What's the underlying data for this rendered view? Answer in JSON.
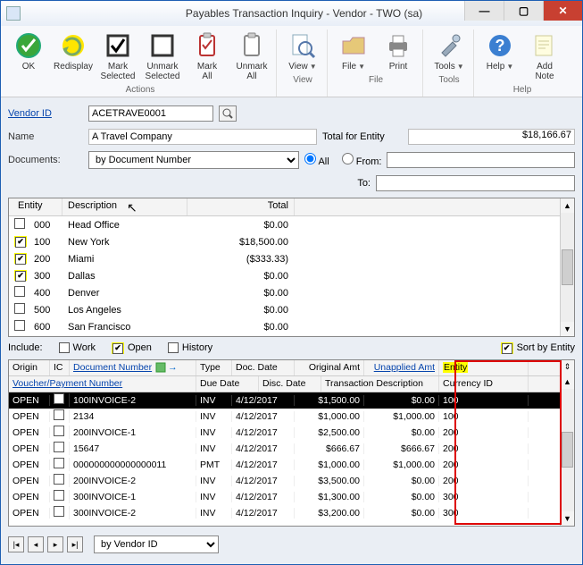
{
  "window": {
    "title": "Payables Transaction Inquiry - Vendor  -  TWO (sa)"
  },
  "ribbon": {
    "ok": "OK",
    "redisplay": "Redisplay",
    "mark_sel": "Mark\nSelected",
    "unmark_sel": "Unmark\nSelected",
    "mark_all": "Mark\nAll",
    "unmark_all": "Unmark\nAll",
    "view": "View",
    "file": "File",
    "print": "Print",
    "tools": "Tools",
    "help": "Help",
    "add_note": "Add\nNote",
    "group_actions": "Actions",
    "group_view": "View",
    "group_file": "File",
    "group_tools": "Tools",
    "group_help": "Help"
  },
  "form": {
    "vendor_id_label": "Vendor ID",
    "vendor_id": "ACETRAVE0001",
    "name_label": "Name",
    "name_value": "A Travel Company",
    "total_entity_label": "Total for Entity",
    "total_entity_value": "$18,166.67",
    "documents_label": "Documents:",
    "documents_value": "by Document Number",
    "all_label": "All",
    "from_label": "From:",
    "to_label": "To:"
  },
  "entity_grid": {
    "h_entity": "Entity",
    "h_desc": "Description",
    "h_total": "Total",
    "rows": [
      {
        "checked": false,
        "hl": false,
        "entity": "000",
        "desc": "Head Office",
        "total": "$0.00"
      },
      {
        "checked": true,
        "hl": true,
        "entity": "100",
        "desc": "New York",
        "total": "$18,500.00"
      },
      {
        "checked": true,
        "hl": true,
        "entity": "200",
        "desc": "Miami",
        "total": "($333.33)"
      },
      {
        "checked": true,
        "hl": true,
        "entity": "300",
        "desc": "Dallas",
        "total": "$0.00"
      },
      {
        "checked": false,
        "hl": false,
        "entity": "400",
        "desc": "Denver",
        "total": "$0.00"
      },
      {
        "checked": false,
        "hl": false,
        "entity": "500",
        "desc": "Los Angeles",
        "total": "$0.00"
      },
      {
        "checked": false,
        "hl": false,
        "entity": "600",
        "desc": "San Francisco",
        "total": "$0.00"
      }
    ]
  },
  "include": {
    "label": "Include:",
    "work": "Work",
    "open": "Open",
    "history": "History",
    "sort": "Sort by Entity"
  },
  "trans": {
    "h_origin": "Origin",
    "h_ic": "IC",
    "h_docnum": "Document Number",
    "h_type": "Type",
    "h_docdate": "Doc. Date",
    "h_orig": "Original Amt",
    "h_unapplied": "Unapplied Amt",
    "h_entity": "Entity",
    "h_vouch": "Voucher/Payment Number",
    "h_due": "Due Date",
    "h_disc": "Disc. Date",
    "h_transdesc": "Transaction Description",
    "h_curr": "Currency ID",
    "rows": [
      {
        "sel": true,
        "origin": "OPEN",
        "doc": "100INVOICE-2",
        "type": "INV",
        "date": "4/12/2017",
        "orig": "$1,500.00",
        "un": "$0.00",
        "ent": "100"
      },
      {
        "sel": false,
        "origin": "OPEN",
        "doc": "2134",
        "type": "INV",
        "date": "4/12/2017",
        "orig": "$1,000.00",
        "un": "$1,000.00",
        "ent": "100"
      },
      {
        "sel": false,
        "origin": "OPEN",
        "doc": "200INVOICE-1",
        "type": "INV",
        "date": "4/12/2017",
        "orig": "$2,500.00",
        "un": "$0.00",
        "ent": "200"
      },
      {
        "sel": false,
        "origin": "OPEN",
        "doc": "15647",
        "type": "INV",
        "date": "4/12/2017",
        "orig": "$666.67",
        "un": "$666.67",
        "ent": "200"
      },
      {
        "sel": false,
        "origin": "OPEN",
        "doc": "000000000000000011",
        "type": "PMT",
        "date": "4/12/2017",
        "orig": "$1,000.00",
        "un": "$1,000.00",
        "ent": "200"
      },
      {
        "sel": false,
        "origin": "OPEN",
        "doc": "200INVOICE-2",
        "type": "INV",
        "date": "4/12/2017",
        "orig": "$3,500.00",
        "un": "$0.00",
        "ent": "200"
      },
      {
        "sel": false,
        "origin": "OPEN",
        "doc": "300INVOICE-1",
        "type": "INV",
        "date": "4/12/2017",
        "orig": "$1,300.00",
        "un": "$0.00",
        "ent": "300"
      },
      {
        "sel": false,
        "origin": "OPEN",
        "doc": "300INVOICE-2",
        "type": "INV",
        "date": "4/12/2017",
        "orig": "$3,200.00",
        "un": "$0.00",
        "ent": "300"
      }
    ]
  },
  "nav": {
    "by": "by Vendor ID"
  }
}
